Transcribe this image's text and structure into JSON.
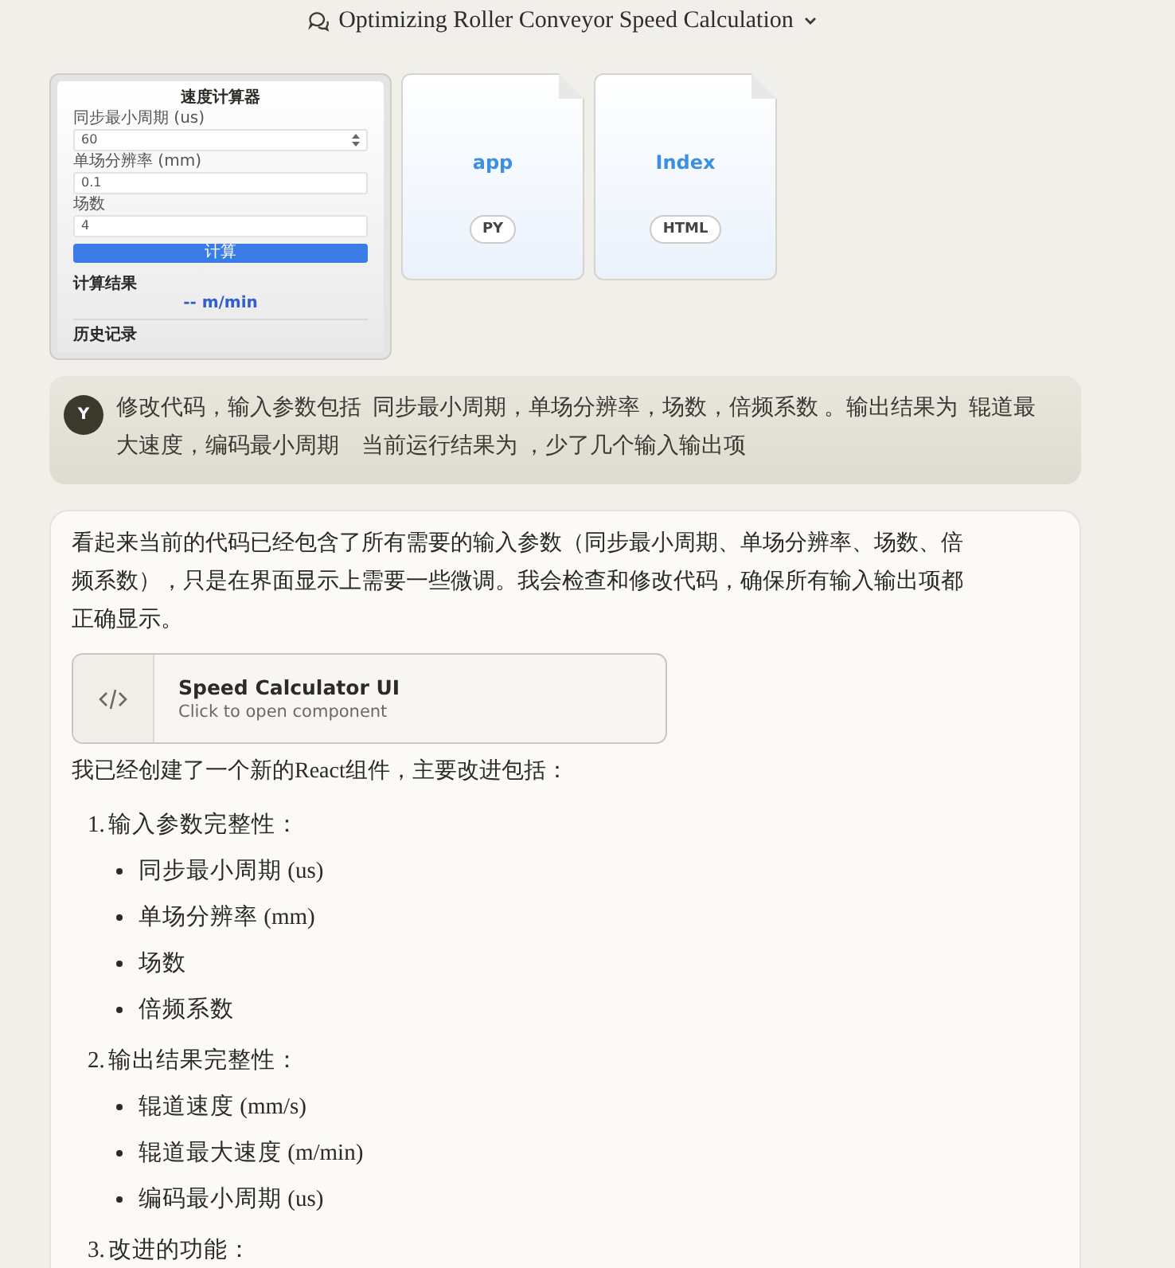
{
  "header": {
    "title": "Optimizing Roller Conveyor Speed Calculation"
  },
  "attachments": [
    {
      "kind": "screenshot",
      "title": "速度计算器",
      "fields": [
        {
          "label": "同步最小周期 (us)",
          "value": "60",
          "spinner": true
        },
        {
          "label": "单场分辨率 (mm)",
          "value": "0.1",
          "spinner": false
        },
        {
          "label": "场数",
          "value": "4",
          "spinner": false
        }
      ],
      "button": "计算",
      "result_label": "计算结果",
      "result_value": "-- m/min",
      "history_label": "历史记录"
    },
    {
      "kind": "file",
      "name": "app",
      "type": "PY"
    },
    {
      "kind": "file",
      "name": "Index",
      "type": "HTML"
    }
  ],
  "user_message": {
    "avatar": "Y",
    "text": "修改代码，输入参数包括  同步最小周期，单场分辨率，场数，倍频系数 。输出结果为  辊道最大速度，编码最小周期    当前运行结果为 ，少了几个输入输出项"
  },
  "response": {
    "intro": "看起来当前的代码已经包含了所有需要的输入参数（同步最小周期、单场分辨率、场数、倍频系数），只是在界面显示上需要一些微调。我会检查和修改代码，确保所有输入输出项都正确显示。",
    "artifact": {
      "title": "Speed Calculator UI",
      "subtitle": "Click to open component"
    },
    "summary": "我已经创建了一个新的React组件，主要改进包括：",
    "sections": [
      {
        "number": "1.",
        "title": "输入参数完整性：",
        "items": [
          "同步最小周期 (us)",
          "单场分辨率 (mm)",
          "场数",
          "倍频系数"
        ]
      },
      {
        "number": "2.",
        "title": "输出结果完整性：",
        "items": [
          "辊道速度 (mm/s)",
          "辊道最大速度 (m/min)",
          "编码最小周期 (us)"
        ]
      },
      {
        "number": "3.",
        "title": "改进的功能："
      }
    ]
  }
}
